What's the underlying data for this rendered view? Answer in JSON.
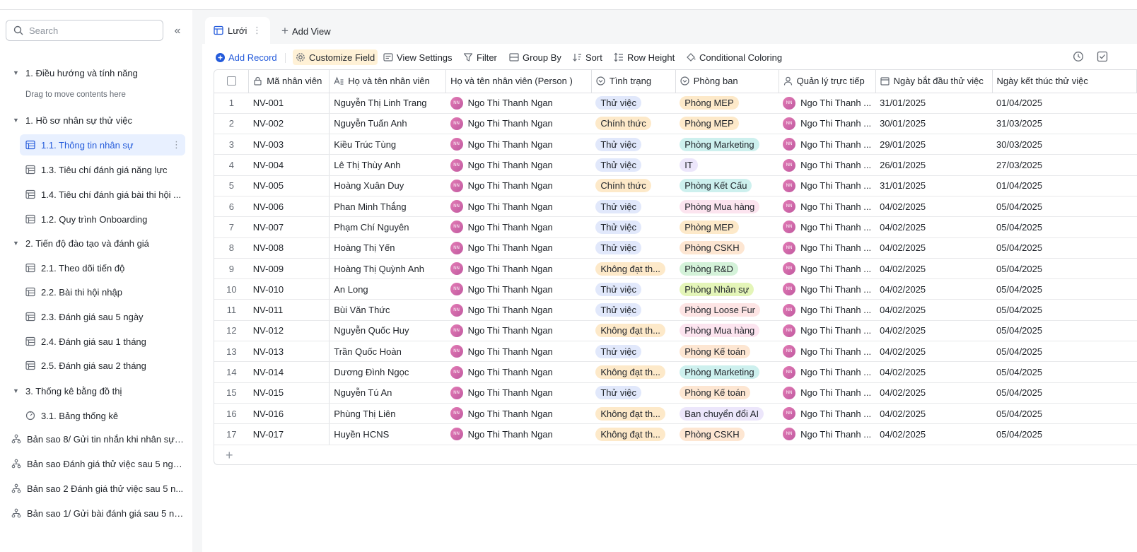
{
  "sidebar": {
    "search_placeholder": "Search",
    "items": [
      {
        "label": "1. Điều hướng và tính năng",
        "type": "group"
      },
      {
        "label": "Drag to move contents here",
        "type": "hint"
      },
      {
        "label": "1. Hồ sơ nhân sự thử việc",
        "type": "group"
      },
      {
        "label": "1.1. Thông tin nhân sự",
        "type": "table",
        "active": true
      },
      {
        "label": "1.3. Tiêu chí đánh giá năng lực",
        "type": "table"
      },
      {
        "label": "1.4. Tiêu chí đánh giá bài thi hội ...",
        "type": "table"
      },
      {
        "label": "1.2. Quy trình Onboarding",
        "type": "table"
      },
      {
        "label": "2. Tiến độ đào tạo và đánh giá",
        "type": "group"
      },
      {
        "label": "2.1. Theo dõi tiến độ",
        "type": "table"
      },
      {
        "label": "2.2. Bài thi hội nhập",
        "type": "table"
      },
      {
        "label": "2.3. Đánh giá sau 5 ngày",
        "type": "table"
      },
      {
        "label": "2.4. Đánh giá sau 1 tháng",
        "type": "table"
      },
      {
        "label": "2.5. Đánh giá sau 2 tháng",
        "type": "table"
      },
      {
        "label": "3. Thống kê bằng đồ thị",
        "type": "group"
      },
      {
        "label": "3.1. Bảng thống kê",
        "type": "dashboard"
      },
      {
        "label": "Bản sao 8/ Gửi tin nhắn khi nhân sự ...",
        "type": "workflow"
      },
      {
        "label": "Bản sao Đánh giá thử việc sau 5 ngà...",
        "type": "workflow"
      },
      {
        "label": "Bản sao 2 Đánh giá thử việc sau 5 n...",
        "type": "workflow"
      },
      {
        "label": "Bản sao 1/ Gửi bài đánh giá sau 5 ng...",
        "type": "workflow"
      }
    ]
  },
  "tabs": {
    "active_label": "Lưới",
    "add_view_label": "Add View"
  },
  "toolbar": {
    "add_record": "Add Record",
    "customize_field": "Customize Field",
    "view_settings": "View Settings",
    "filter": "Filter",
    "group_by": "Group By",
    "sort": "Sort",
    "row_height": "Row Height",
    "conditional_coloring": "Conditional Coloring"
  },
  "table": {
    "columns": [
      "Mã nhân viên",
      "Họ và tên nhân viên",
      "Họ và tên nhân viên (Person )",
      "Tình trạng",
      "Phòng ban",
      "Quản lý trực tiếp",
      "Ngày bắt đầu thử việc",
      "Ngày kết thúc thử việc"
    ],
    "avatar_initials": "NN",
    "rows": [
      {
        "n": "1",
        "id": "NV-001",
        "name": "Nguyễn Thị Linh Trang",
        "person": "Ngo Thi Thanh Ngan",
        "status": "Thử việc",
        "dept": "Phòng MEP",
        "manager": "Ngo Thi Thanh ...",
        "start": "31/01/2025",
        "end": "01/04/2025"
      },
      {
        "n": "2",
        "id": "NV-002",
        "name": "Nguyễn Tuấn Anh",
        "person": "Ngo Thi Thanh Ngan",
        "status": "Chính thức",
        "dept": "Phòng MEP",
        "manager": "Ngo Thi Thanh ...",
        "start": "30/01/2025",
        "end": "31/03/2025"
      },
      {
        "n": "3",
        "id": "NV-003",
        "name": "Kiều Trúc Tùng",
        "person": "Ngo Thi Thanh Ngan",
        "status": "Thử việc",
        "dept": "Phòng Marketing",
        "manager": "Ngo Thi Thanh ...",
        "start": "29/01/2025",
        "end": "30/03/2025"
      },
      {
        "n": "4",
        "id": "NV-004",
        "name": "Lê Thị Thùy Anh",
        "person": "Ngo Thi Thanh Ngan",
        "status": "Thử việc",
        "dept": "IT",
        "manager": "Ngo Thi Thanh ...",
        "start": "26/01/2025",
        "end": "27/03/2025"
      },
      {
        "n": "5",
        "id": "NV-005",
        "name": "Hoàng Xuân Duy",
        "person": "Ngo Thi Thanh Ngan",
        "status": "Chính thức",
        "dept": "Phòng Kết Cấu",
        "manager": "Ngo Thi Thanh ...",
        "start": "31/01/2025",
        "end": "01/04/2025"
      },
      {
        "n": "6",
        "id": "NV-006",
        "name": "Phan Minh Thắng",
        "person": "Ngo Thi Thanh Ngan",
        "status": "Thử việc",
        "dept": "Phòng Mua hàng",
        "manager": "Ngo Thi Thanh ...",
        "start": "04/02/2025",
        "end": "05/04/2025"
      },
      {
        "n": "7",
        "id": "NV-007",
        "name": "Phạm Chí Nguyên",
        "person": "Ngo Thi Thanh Ngan",
        "status": "Thử việc",
        "dept": "Phòng MEP",
        "manager": "Ngo Thi Thanh ...",
        "start": "04/02/2025",
        "end": "05/04/2025"
      },
      {
        "n": "8",
        "id": "NV-008",
        "name": "Hoàng Thị Yến",
        "person": "Ngo Thi Thanh Ngan",
        "status": "Thử việc",
        "dept": "Phòng CSKH",
        "manager": "Ngo Thi Thanh ...",
        "start": "04/02/2025",
        "end": "05/04/2025"
      },
      {
        "n": "9",
        "id": "NV-009",
        "name": "Hoàng Thị Quỳnh Anh",
        "person": "Ngo Thi Thanh Ngan",
        "status": "Không đạt th...",
        "dept": "Phòng R&D",
        "manager": "Ngo Thi Thanh ...",
        "start": "04/02/2025",
        "end": "05/04/2025"
      },
      {
        "n": "10",
        "id": "NV-010",
        "name": "An Long",
        "person": "Ngo Thi Thanh Ngan",
        "status": "Thử việc",
        "dept": "Phòng Nhân sự",
        "manager": "Ngo Thi Thanh ...",
        "start": "04/02/2025",
        "end": "05/04/2025"
      },
      {
        "n": "11",
        "id": "NV-011",
        "name": "Bùi Văn Thức",
        "person": "Ngo Thi Thanh Ngan",
        "status": "Thử việc",
        "dept": "Phòng Loose Fur",
        "manager": "Ngo Thi Thanh ...",
        "start": "04/02/2025",
        "end": "05/04/2025"
      },
      {
        "n": "12",
        "id": "NV-012",
        "name": "Nguyễn Quốc Huy",
        "person": "Ngo Thi Thanh Ngan",
        "status": "Không đạt th...",
        "dept": "Phòng Mua hàng",
        "manager": "Ngo Thi Thanh ...",
        "start": "04/02/2025",
        "end": "05/04/2025"
      },
      {
        "n": "13",
        "id": "NV-013",
        "name": "Trần Quốc Hoàn",
        "person": "Ngo Thi Thanh Ngan",
        "status": "Thử việc",
        "dept": "Phòng Kế toán",
        "manager": "Ngo Thi Thanh ...",
        "start": "04/02/2025",
        "end": "05/04/2025"
      },
      {
        "n": "14",
        "id": "NV-014",
        "name": "Dương Đình Ngọc",
        "person": "Ngo Thi Thanh Ngan",
        "status": "Không đạt th...",
        "dept": "Phòng Marketing",
        "manager": "Ngo Thi Thanh ...",
        "start": "04/02/2025",
        "end": "05/04/2025"
      },
      {
        "n": "15",
        "id": "NV-015",
        "name": "Nguyễn Tú An",
        "person": "Ngo Thi Thanh Ngan",
        "status": "Thử việc",
        "dept": "Phòng Kế toán",
        "manager": "Ngo Thi Thanh ...",
        "start": "04/02/2025",
        "end": "05/04/2025"
      },
      {
        "n": "16",
        "id": "NV-016",
        "name": "Phùng Thị Liên",
        "person": "Ngo Thi Thanh Ngan",
        "status": "Không đạt th...",
        "dept": "Ban chuyển đổi AI",
        "manager": "Ngo Thi Thanh ...",
        "start": "04/02/2025",
        "end": "05/04/2025"
      },
      {
        "n": "17",
        "id": "NV-017",
        "name": "Huyền HCNS",
        "person": "Ngo Thi Thanh Ngan",
        "status": "Không đạt th...",
        "dept": "Phòng CSKH",
        "manager": "Ngo Thi Thanh ...",
        "start": "04/02/2025",
        "end": "05/04/2025"
      }
    ]
  },
  "colors": {
    "accent": "#245bdb",
    "status": {
      "Thử việc": "#e1e8fb",
      "Chính thức": "#fde9c9",
      "Không đạt th...": "#fde9c9"
    },
    "dept": {
      "Phòng MEP": "#fde9c9",
      "Phòng Marketing": "#cdf0ee",
      "IT": "#ece6fb",
      "Phòng Kết Cấu": "#cdf0ee",
      "Phòng Mua hàng": "#fce4ef",
      "Phòng CSKH": "#fde6d2",
      "Phòng R&D": "#d4f2d9",
      "Phòng Nhân sự": "#e4f5b8",
      "Phòng Loose Fur": "#fde4e4",
      "Phòng Kế toán": "#fde6d2",
      "Ban chuyển đổi AI": "#ece6fb"
    }
  }
}
